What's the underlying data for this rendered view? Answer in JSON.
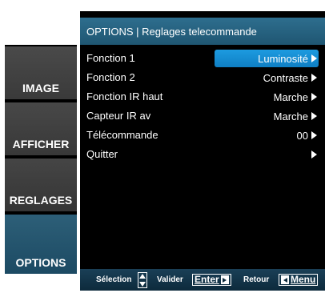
{
  "sidebar": {
    "items": [
      {
        "label": "IMAGE"
      },
      {
        "label": "AFFICHER"
      },
      {
        "label": "REGLAGES"
      },
      {
        "label": "OPTIONS",
        "selected": true
      }
    ]
  },
  "header": {
    "title": "OPTIONS | Reglages telecommande"
  },
  "menu": {
    "rows": [
      {
        "label": "Fonction 1",
        "value": "Luminosité",
        "selected": true
      },
      {
        "label": "Fonction 2",
        "value": "Contraste"
      },
      {
        "label": "Fonction IR haut",
        "value": "Marche"
      },
      {
        "label": "Capteur IR av",
        "value": "Marche"
      },
      {
        "label": "Télécommande",
        "value": "00"
      },
      {
        "label": "Quitter",
        "value": ""
      }
    ]
  },
  "footer": {
    "selection_label": "Sélection",
    "validate_label": "Valider",
    "enter_key": "Enter",
    "back_label": "Retour",
    "menu_key": "Menu"
  },
  "colors": {
    "accent_header": "#2e6e8e",
    "selected_value": "#1d9be0",
    "sidebar_selected": "#2d5f78",
    "footer_bg": "#1a3f57"
  },
  "icons": [
    "up-down-arrows-icon",
    "right-arrow-icon",
    "left-arrow-icon"
  ]
}
